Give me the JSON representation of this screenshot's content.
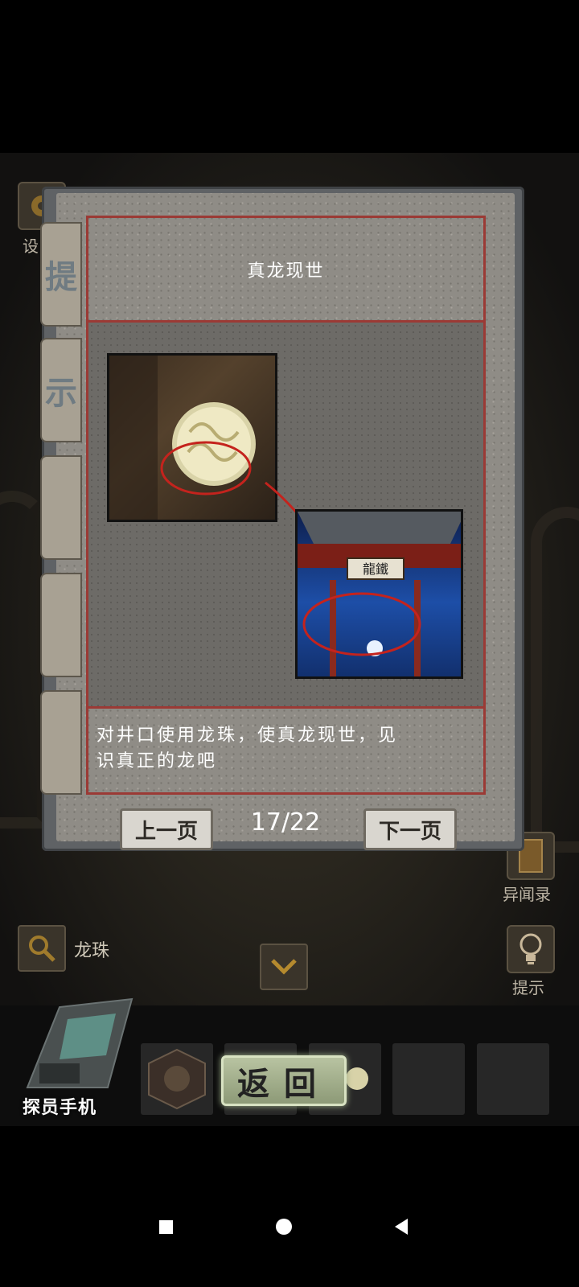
{
  "hint_book": {
    "side_tabs": [
      "提",
      "示",
      "",
      "",
      ""
    ],
    "title": "真龙现世",
    "description_line1": "对井口使用龙珠，使真龙现世，见",
    "description_line2": "识真正的龙吧",
    "prev_label": "上一页",
    "next_label": "下一页",
    "page_indicator": "17/22",
    "image_temple_sign": "龍鐵"
  },
  "top_left": {
    "settings_label": "设"
  },
  "right_side": {
    "records_label": "异闻录",
    "hint_label": "提示"
  },
  "search": {
    "item_name": "龙珠"
  },
  "inventory": {
    "phone_label": "探员手机",
    "return_label": "返回",
    "slot_count": 5
  },
  "colors": {
    "frame_red": "#9b3a35",
    "return_green": "#b8c3a1"
  }
}
